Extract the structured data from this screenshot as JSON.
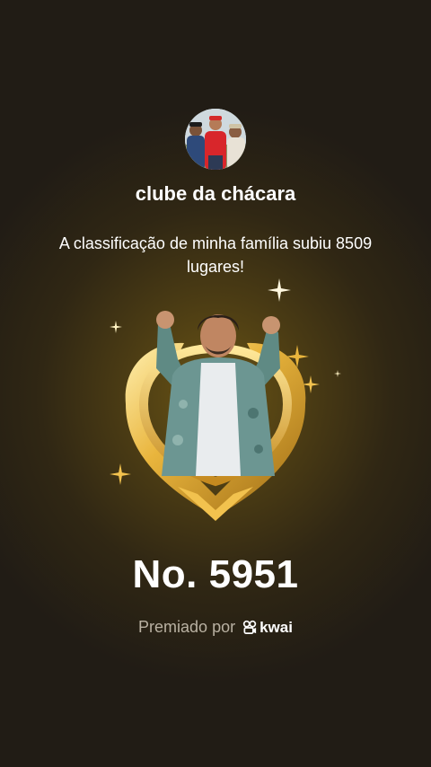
{
  "family": {
    "name": "clube da chácara",
    "avatar_icon": "family-group-photo"
  },
  "message": "A classificação de minha família subiu 8509 lugares!",
  "rank": {
    "label": "No. 5951",
    "position": 5951,
    "places_up": 8509
  },
  "award": {
    "prefix": "Premiado por",
    "brand_name": "kwai",
    "brand_icon": "kwai-logo-icon"
  },
  "badge": {
    "icon": "gold-laurel-badge-icon",
    "figure": "celebrating-person-image"
  },
  "colors": {
    "background": "#231d14",
    "glow": "#6a5414",
    "gold": "#e9b53d",
    "muted_text": "#b9b1a2"
  }
}
